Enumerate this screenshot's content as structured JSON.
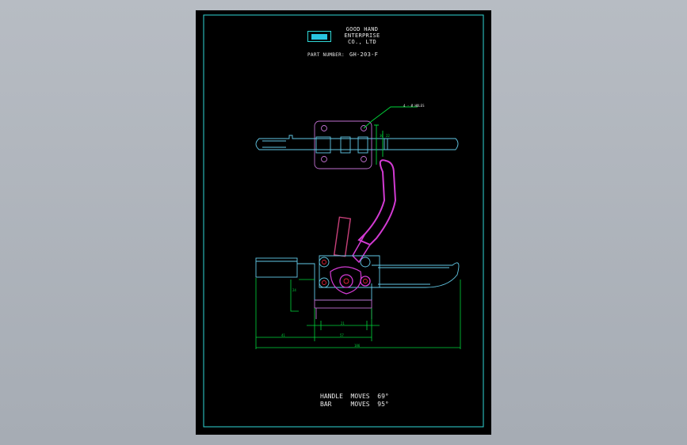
{
  "header": {
    "company": [
      "GOOD HAND",
      "ENTERPRISE",
      "CO., LTD"
    ],
    "part_number_label": "PART NUMBER:",
    "part_number": "GH-203-F"
  },
  "notes": {
    "holes": "4 - Ø HOLES"
  },
  "dimensions": {
    "overall_length": "186",
    "left_offset": "41",
    "base_width": "57",
    "hole_spacing": "21",
    "height": "24",
    "top_a": "30",
    "top_b": "22"
  },
  "footer": {
    "handle_moves": "HANDLE  MOVES  69°",
    "bar_moves": "BAR     MOVES  95°"
  },
  "colors": {
    "frame": "#2fd6d6",
    "dimension": "#00d43a",
    "outline": "#62c8e6",
    "handle": "#d23ad2",
    "hidden": "#e0243a",
    "grip": "#c8407a"
  }
}
